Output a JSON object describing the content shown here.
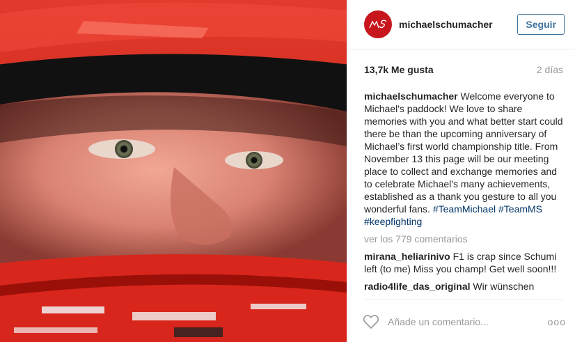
{
  "post": {
    "image_alt": "Michael Schumacher in a red racing helmet"
  },
  "header": {
    "username": "michaelschumacher",
    "follow_label": "Seguir"
  },
  "stats": {
    "likes": "13,7k Me gusta",
    "time": "2 días"
  },
  "caption": {
    "username": "michaelschumacher",
    "text": " Welcome everyone to Michael's paddock! We love to share memories with you and what better start could there be than the upcoming anniversary of Michael’s first world championship title. From November 13 this page will be our meeting place to collect and exchange memories and to celebrate Michael's many achievements, established as a thank you gesture to all you wonderful fans. ",
    "hashtags": [
      "#TeamMichael",
      "#TeamMS",
      "#keepfighting"
    ]
  },
  "view_all": "ver los 779 comentarios",
  "comments": [
    {
      "username": "mirana_heliarinivo",
      "text": " F1 is crap since Schumi left (to me) Miss you champ! Get well soon!!!"
    },
    {
      "username": "radio4life_das_original",
      "text": " Wir wünschen"
    }
  ],
  "footer": {
    "comment_placeholder": "Añade un comentario...",
    "more_label": "ooo"
  },
  "colors": {
    "accent": "#3f729b",
    "hashtag": "#003569",
    "muted": "#999999",
    "avatar": "#c8161d"
  },
  "icons": {
    "heart": "heart-icon",
    "avatar_logo": "ms-logo-icon",
    "more": "more-options-icon"
  }
}
